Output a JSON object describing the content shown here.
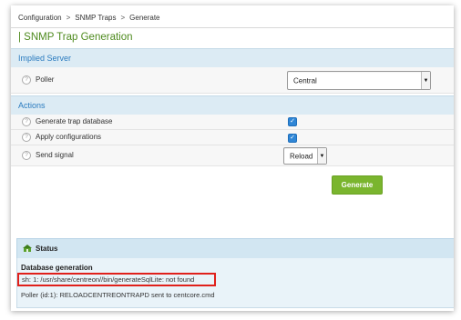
{
  "breadcrumb": {
    "items": [
      "Configuration",
      "SNMP Traps",
      "Generate"
    ],
    "separator": ">"
  },
  "page": {
    "title": "| SNMP Trap Generation"
  },
  "implied_server": {
    "heading": "Implied Server",
    "poller_label": "Poller",
    "poller_value": "Central"
  },
  "actions": {
    "heading": "Actions",
    "generate_trap_db_label": "Generate trap database",
    "generate_trap_db_checked": true,
    "apply_configurations_label": "Apply configurations",
    "apply_configurations_checked": true,
    "send_signal_label": "Send signal",
    "send_signal_value": "Reload",
    "generate_button": "Generate"
  },
  "status": {
    "heading": "Status",
    "db_generation_label": "Database generation",
    "error_message": "sh: 1: /usr/share/centreon//bin/generateSqlLite: not found",
    "poller_message": "Poller (id:1): RELOADCENTREONTRAPD sent to centcore.cmd"
  },
  "colors": {
    "title_green": "#4e8a1e",
    "section_blue": "#2a7bbf",
    "button_green": "#7ab52e",
    "error_border": "#e0201b",
    "checkbox_blue": "#2f86d6"
  }
}
